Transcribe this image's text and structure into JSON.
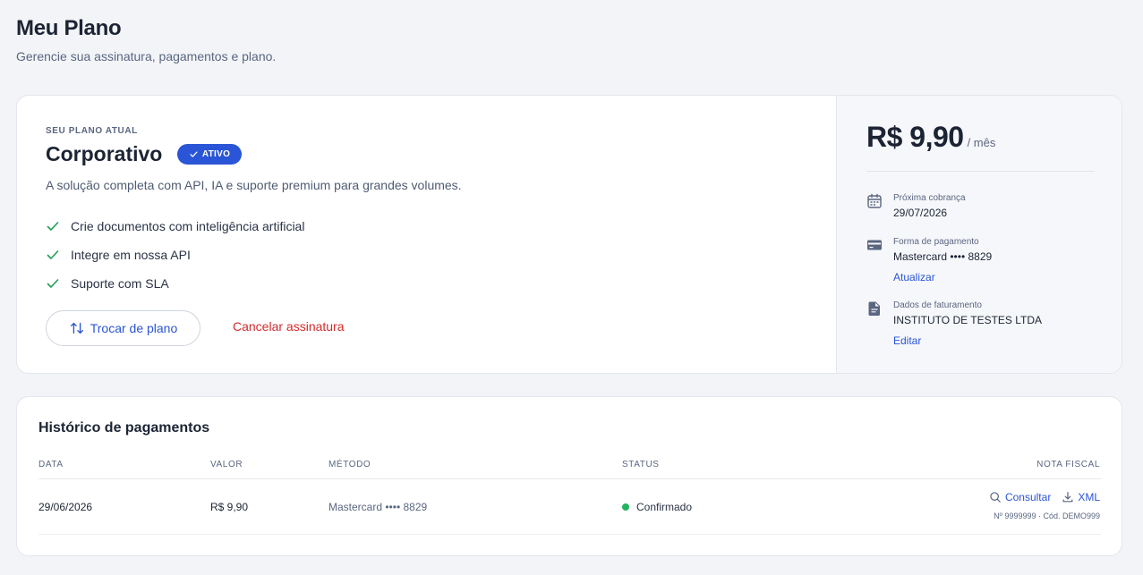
{
  "header": {
    "title": "Meu Plano",
    "subtitle": "Gerencie sua assinatura, pagamentos e plano."
  },
  "plan": {
    "eyebrow": "SEU PLANO ATUAL",
    "name": "Corporativo",
    "badge": "ATIVO",
    "description": "A solução completa com API, IA e suporte premium para grandes volumes.",
    "features": [
      "Crie documentos com inteligência artificial",
      "Integre em nossa API",
      "Suporte com SLA"
    ],
    "switch_label": "Trocar de plano",
    "cancel_label": "Cancelar assinatura"
  },
  "billing": {
    "price": "R$ 9,90",
    "period": "/ mês",
    "next_charge_label": "Próxima cobrança",
    "next_charge_value": "29/07/2026",
    "payment_label": "Forma de pagamento",
    "payment_value": "Mastercard •••• 8829",
    "payment_link": "Atualizar",
    "invoice_label": "Dados de faturamento",
    "invoice_value": "INSTITUTO DE TESTES LTDA",
    "invoice_link": "Editar"
  },
  "history": {
    "title": "Histórico de pagamentos",
    "columns": [
      "DATA",
      "VALOR",
      "MÉTODO",
      "STATUS",
      "NOTA FISCAL"
    ],
    "rows": [
      {
        "date": "29/06/2026",
        "value": "R$ 9,90",
        "method": "Mastercard •••• 8829",
        "status": "Confirmado",
        "nf_consult": "Consultar",
        "nf_xml": "XML",
        "nf_note": "Nº 9999999 · Cód. DEMO999"
      }
    ]
  },
  "colors": {
    "accent": "#2a55d6",
    "danger": "#d22b2b",
    "success": "#22b35e",
    "check": "#1f9d55"
  }
}
